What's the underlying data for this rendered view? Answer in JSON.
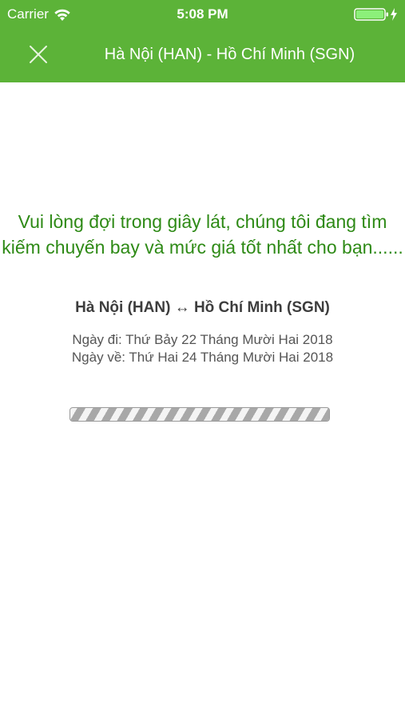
{
  "status_bar": {
    "carrier": "Carrier",
    "time": "5:08 PM",
    "battery_level": 1.0,
    "battery_color": "#8cf07a"
  },
  "nav": {
    "close_icon": "close-icon",
    "title": "Hà Nội (HAN) - Hồ Chí Minh (SGN)"
  },
  "main": {
    "waiting_message": "Vui lòng đợi trong giây lát, chúng tôi đang tìm kiếm chuyến bay và mức giá tốt nhất cho bạn......",
    "route": "Hà Nội (HAN) ↔ Hồ Chí Minh (SGN)",
    "depart_date": "Ngày đi: Thứ Bảy 22 Tháng Mười Hai 2018",
    "return_date": "Ngày về: Thứ Hai 24 Tháng Mười Hai 2018",
    "progress": 1.0
  },
  "colors": {
    "header_bg": "#5cb338",
    "accent_text": "#2e8a16"
  }
}
